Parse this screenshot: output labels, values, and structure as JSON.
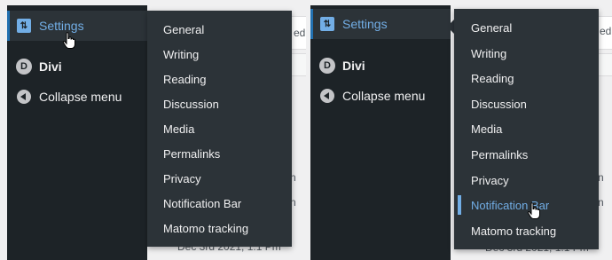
{
  "left": {
    "sidebar": [
      {
        "label": "Settings",
        "icon": "settings-icon",
        "active": true
      },
      {
        "label": "Divi",
        "icon": "divi-icon",
        "active": false
      },
      {
        "label": "Collapse menu",
        "icon": "collapse-icon",
        "active": false
      }
    ],
    "submenu": [
      "General",
      "Writing",
      "Reading",
      "Discussion",
      "Media",
      "Permalinks",
      "Privacy",
      "Notification Bar",
      "Matomo tracking"
    ],
    "background_fragments": [
      "ed",
      "n",
      "n",
      "Dec 3rd 2021, 1:1 Pm"
    ]
  },
  "right": {
    "sidebar": [
      {
        "label": "Settings",
        "icon": "settings-icon",
        "active": true
      },
      {
        "label": "Divi",
        "icon": "divi-icon",
        "active": false
      },
      {
        "label": "Collapse menu",
        "icon": "collapse-icon",
        "active": false
      }
    ],
    "submenu": [
      "General",
      "Writing",
      "Reading",
      "Discussion",
      "Media",
      "Permalinks",
      "Privacy",
      "Notification Bar",
      "Matomo tracking"
    ],
    "hovered_index": 7,
    "background_fragments": [
      "ed",
      "n",
      "n",
      "Dec 3rd 2021, 1:1 Pm"
    ]
  },
  "icons": {
    "settings": "⇅",
    "divi": "D"
  },
  "colors": {
    "sidebar_bg": "#1d2327",
    "submenu_bg": "#2c3338",
    "accent": "#72aee6",
    "text": "#f0f0f1"
  }
}
